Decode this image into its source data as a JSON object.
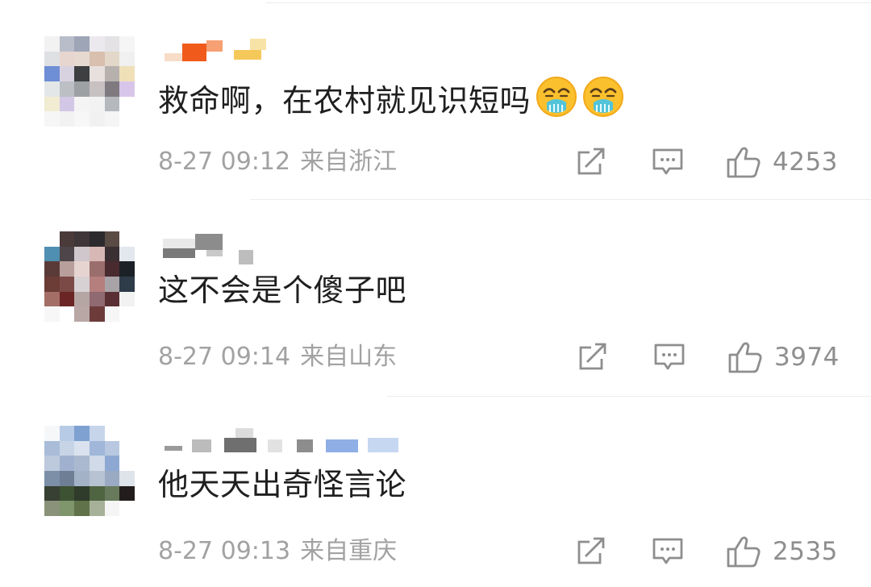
{
  "comments": [
    {
      "text": "救命啊，在农村就见识短吗",
      "emojis": [
        "vomit-face-emoji",
        "vomit-face-emoji"
      ],
      "date": "8-27 09:12",
      "location": "来自浙江",
      "likes": "4253",
      "avatar_colors": [
        "#f2f2f2",
        "#b9bdc9",
        "#9ea5b6",
        "#ece9ee",
        "#e4e2e4",
        "#f5f5f5",
        "#dfe0e4",
        "#e7d6cf",
        "#e6d9d0",
        "#d8bfae",
        "#e3d7c9",
        "#f0f0f0",
        "#6e8ed6",
        "#d8d2e0",
        "#3d3f41",
        "#e8e0dd",
        "#b7b1ad",
        "#f0e0b8",
        "#e4e7e8",
        "#bcbfc4",
        "#9ea1a4",
        "#c7c1c2",
        "#7f7a80",
        "#d8c6ea",
        "#f1ecd2",
        "#d2c7e5",
        "#f4f4f4",
        "#f2f2f2",
        "#b5b8bd",
        "#ffffff",
        "#f6f6f6",
        "#f2f2f2",
        "#f7f7f7",
        "#f1f1f1",
        "#f5f5f5",
        "#ffffff"
      ]
    },
    {
      "text": "这不会是个傻子吧",
      "emojis": [],
      "date": "8-27 09:14",
      "location": "来自山东",
      "likes": "3974",
      "avatar_colors": [
        "#ffffff",
        "#4a3a3a",
        "#3f3639",
        "#2c2a2d",
        "#5b4b45",
        "#ffffff",
        "#4f8fb1",
        "#4d4549",
        "#cfc7cb",
        "#d8b8b5",
        "#3a2f33",
        "#e3e8ef",
        "#5b3b38",
        "#b99f9b",
        "#e6d4d0",
        "#9a6e6c",
        "#482a2f",
        "#1c2127",
        "#6c3c36",
        "#7b4a46",
        "#d8d1d3",
        "#b57f7d",
        "#a8a3a7",
        "#2e3b49",
        "#a36e65",
        "#6a2524",
        "#b6a6a3",
        "#8f6a70",
        "#5a2f33",
        "#f2f2f2",
        "#f7f7f7",
        "#ffffff",
        "#b9a7a6",
        "#6e3b3b",
        "#f6f6f6",
        "#ffffff"
      ]
    },
    {
      "text": "他天天出奇怪言论",
      "emojis": [],
      "date": "8-27 09:13",
      "location": "来自重庆",
      "likes": "2535",
      "avatar_colors": [
        "#f6f7f9",
        "#b8cbe6",
        "#7ea1d2",
        "#c6d5ea",
        "#ffffff",
        "#ffffff",
        "#a9bcd8",
        "#c7d4e6",
        "#d9e2ee",
        "#a0b7da",
        "#b8c8e0",
        "#ffffff",
        "#bdc9dc",
        "#9fb1cf",
        "#aab9cf",
        "#d1dae8",
        "#8da8d2",
        "#ffffff",
        "#7d8fa7",
        "#6e7f95",
        "#a3b2c6",
        "#b7c2d3",
        "#9aaac3",
        "#dfe3ea",
        "#374033",
        "#3d5133",
        "#2f3b2b",
        "#4f6440",
        "#677a5b",
        "#221d1c",
        "#8a9279",
        "#7f956b",
        "#5f7249",
        "#a7b098",
        "#f5f5f5",
        "#ffffff"
      ]
    }
  ]
}
